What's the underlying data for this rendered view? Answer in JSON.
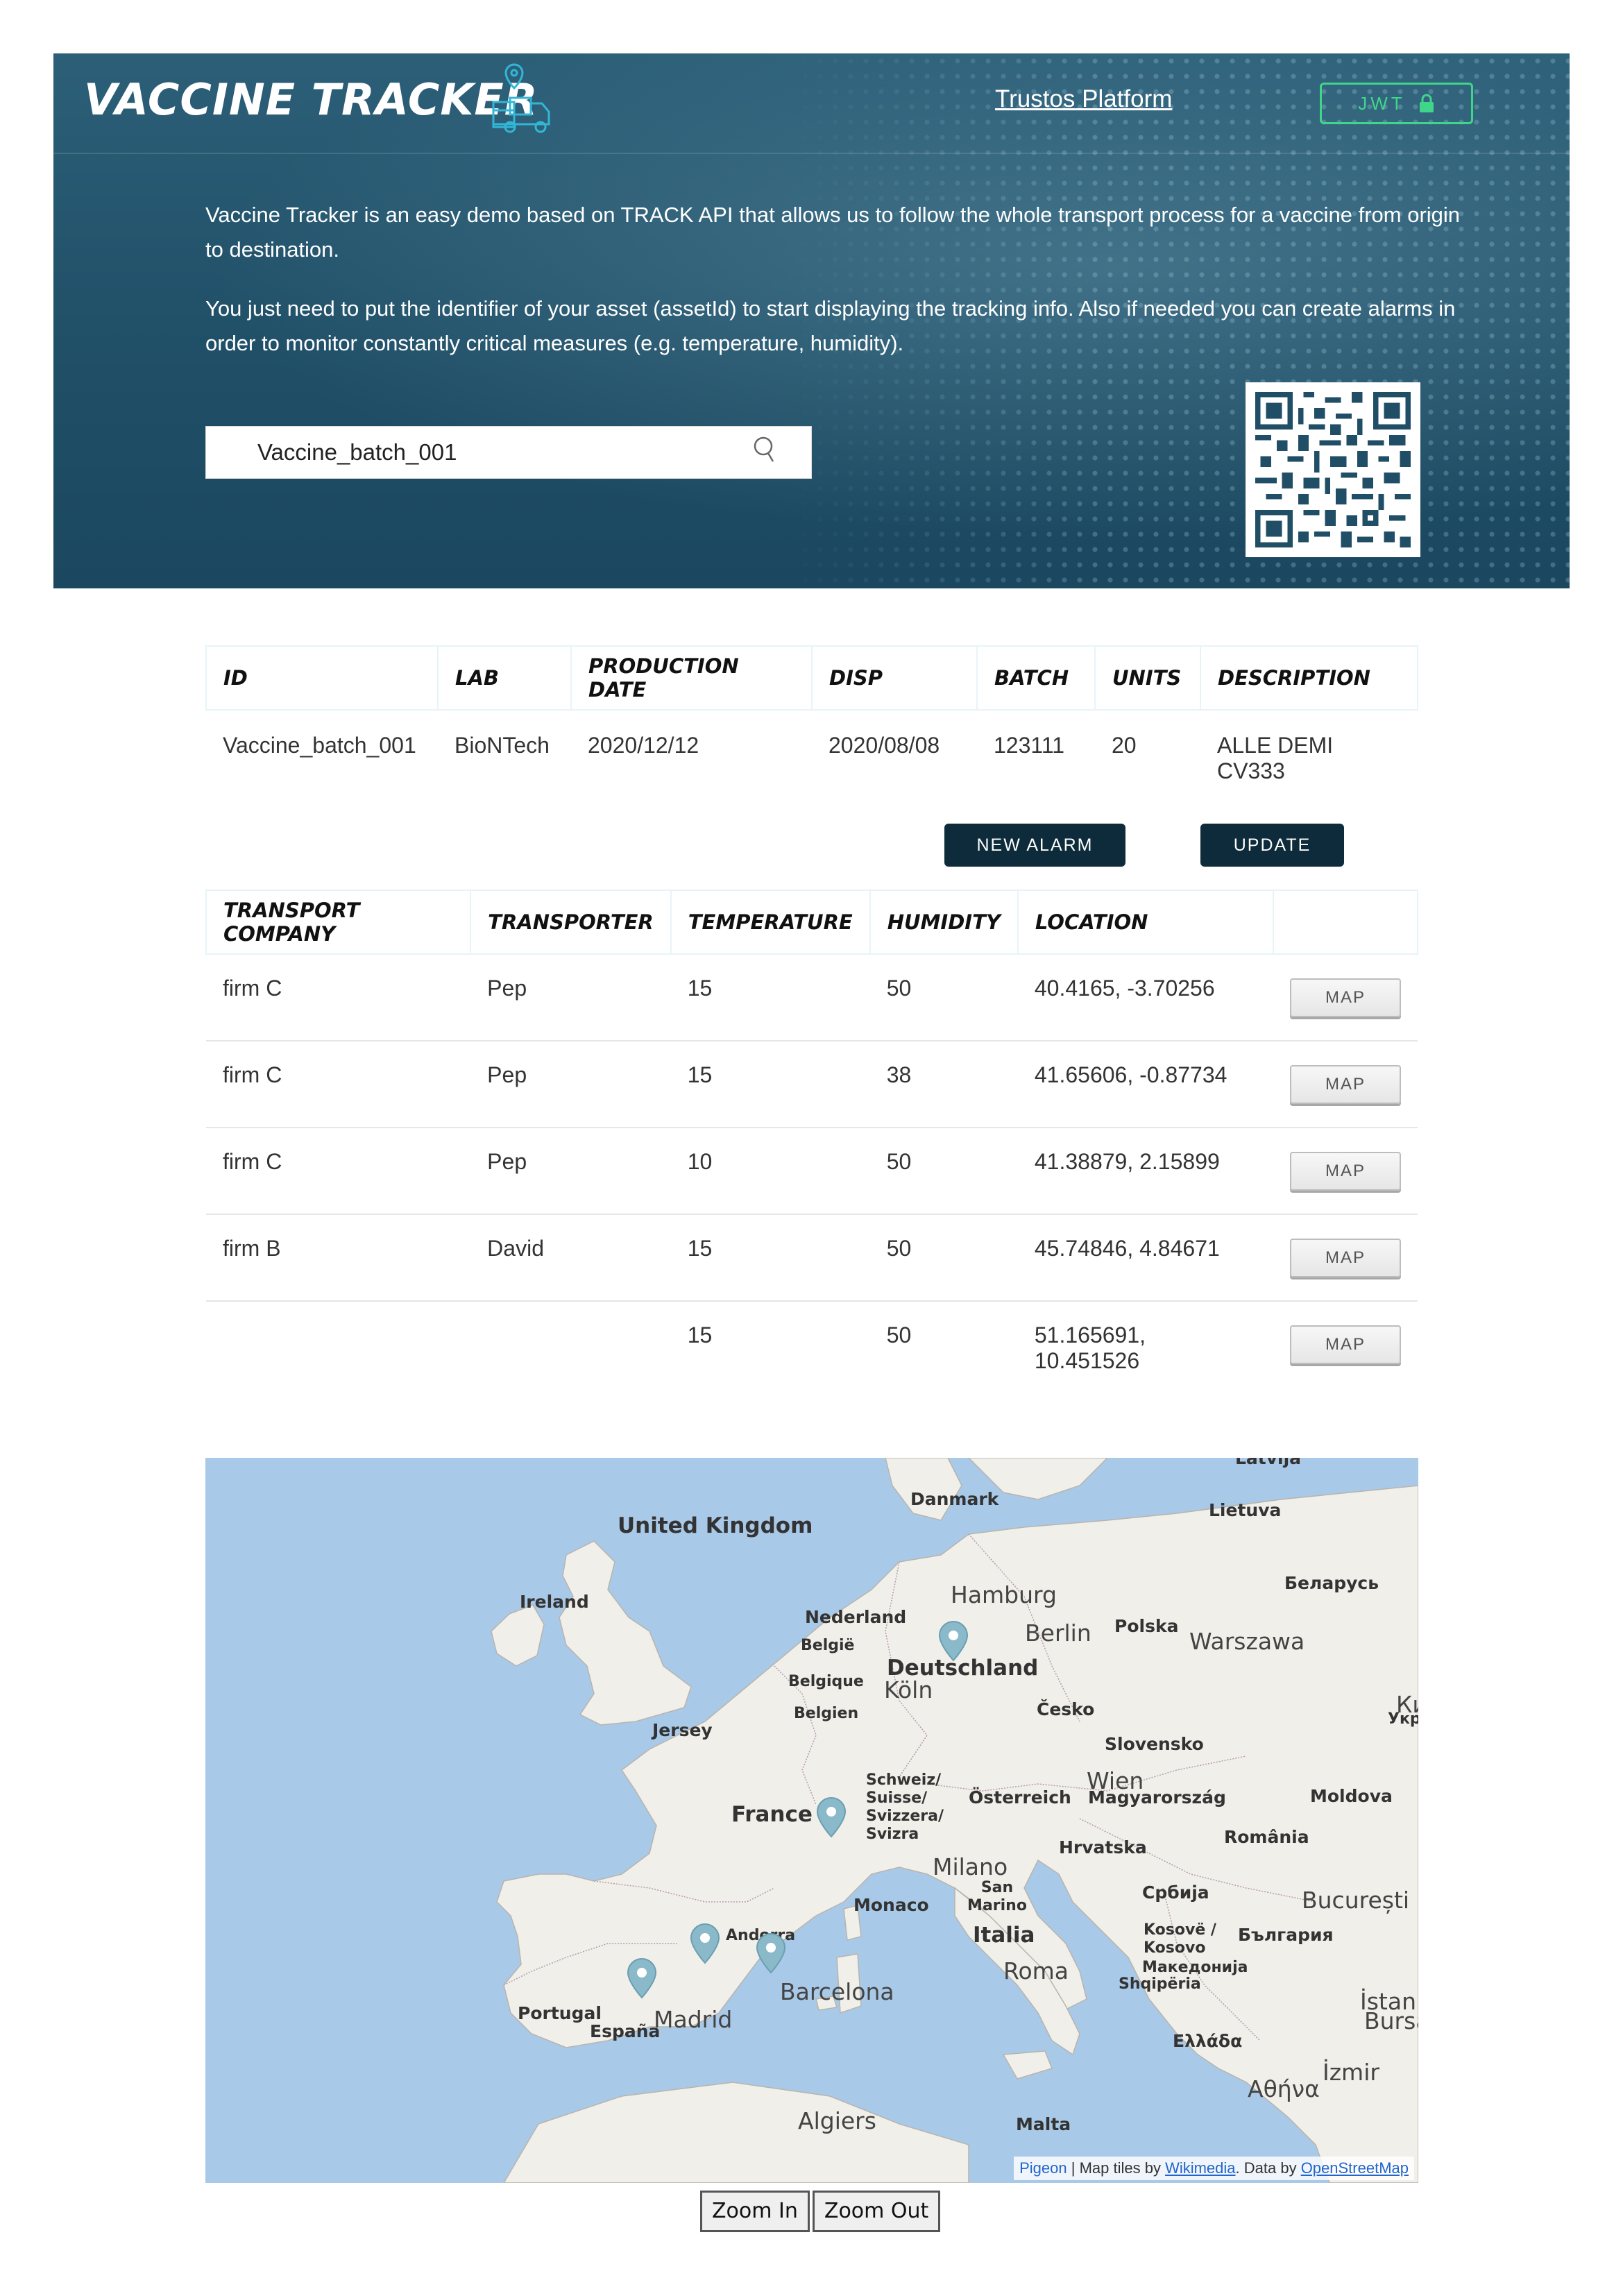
{
  "header": {
    "app_title": "VACCINE TRACKER",
    "platform_link": "Trustos Platform",
    "jwt_label": "JWT",
    "intro_1": "Vaccine Tracker is an easy demo based on TRACK API that allows us to follow the whole transport process for a vaccine from origin to destination.",
    "intro_2": "You just need to put the identifier of your asset (assetId) to start displaying the tracking info. Also if needed you can create alarms in order to monitor constantly critical measures (e.g. temperature, humidity).",
    "search_value": "Vaccine_batch_001",
    "logo_icon": "truck-location-icon",
    "lock_icon": "lock-icon"
  },
  "asset": {
    "columns": [
      "ID",
      "LAB",
      "PRODUCTION DATE",
      "DISP",
      "BATCH",
      "UNITS",
      "DESCRIPTION"
    ],
    "row": [
      "Vaccine_batch_001",
      "BioNTech",
      "2020/12/12",
      "2020/08/08",
      "123111",
      "20",
      "ALLE DEMI CV333"
    ]
  },
  "actions": {
    "new_alarm": "NEW ALARM",
    "update": "UPDATE"
  },
  "transport": {
    "columns": [
      "TRANSPORT COMPANY",
      "TRANSPORTER",
      "TEMPERATURE",
      "HUMIDITY",
      "LOCATION"
    ],
    "map_label": "MAP",
    "rows": [
      {
        "company": "firm C",
        "transporter": "Pep",
        "temperature": "15",
        "humidity": "50",
        "location": "40.4165, -3.70256"
      },
      {
        "company": "firm C",
        "transporter": "Pep",
        "temperature": "15",
        "humidity": "38",
        "location": "41.65606, -0.87734"
      },
      {
        "company": "firm C",
        "transporter": "Pep",
        "temperature": "10",
        "humidity": "50",
        "location": "41.38879, 2.15899"
      },
      {
        "company": "firm B",
        "transporter": "David",
        "temperature": "15",
        "humidity": "50",
        "location": "45.74846, 4.84671"
      },
      {
        "company": "",
        "transporter": "",
        "temperature": "15",
        "humidity": "50",
        "location": "51.165691, 10.451526"
      }
    ],
    "alert_color": "#d33a3a"
  },
  "map": {
    "labels": {
      "uk": "United Kingdom",
      "ireland": "Ireland",
      "danmark": "Danmark",
      "lietuva": "Lietuva",
      "latvija": "Latvija",
      "belarus": "Беларусь",
      "hamburg": "Hamburg",
      "nederland": "Nederland",
      "berlin": "Berlin",
      "polska": "Polska",
      "warszawa": "Warszawa",
      "belgie": "België",
      "belgique": "Belgique",
      "belgien": "Belgien",
      "deutschland": "Deutschland",
      "koln": "Köln",
      "cesko": "Česko",
      "jersey": "Jersey",
      "slovensko": "Slovensko",
      "schweiz": "Schweiz/ Suisse/ Svizzera/ Svizra",
      "osterreich": "Österreich",
      "wien": "Wien",
      "magyar": "Magyarország",
      "moldova": "Moldova",
      "france": "France",
      "hrvatska": "Hrvatska",
      "romania": "România",
      "milano": "Milano",
      "sanmarino": "San Marino",
      "monaco": "Monaco",
      "srbija": "Србија",
      "bucuresti": "București",
      "kosove": "Kosovë / Kosovo",
      "bulgaria": "България",
      "italia": "Italia",
      "andorra": "Andorra",
      "makedonija": "Македонија",
      "shqiperia": "Shqipëria",
      "roma": "Roma",
      "barcelona": "Barcelona",
      "portugal": "Portugal",
      "espana": "España",
      "madrid": "Madrid",
      "istanbul": "İstan",
      "bursa": "Bursa",
      "ellada": "Ελλάδα",
      "izmir": "İzmir",
      "athina": "Αθήνα",
      "algiers": "Algiers",
      "malta": "Malta",
      "kyiv": "Ки",
      "ukraina": "Украї"
    },
    "attribution": {
      "pigeon": "Pigeon",
      "sep1": " | Map tiles by ",
      "wikimedia": "Wikimedia",
      "sep2": ". Data by ",
      "osm": "OpenStreetMap"
    },
    "zoom_in": "Zoom In",
    "zoom_out": "Zoom Out",
    "marker_color": "#8ab9c9",
    "pin_icon": "map-pin-icon"
  }
}
